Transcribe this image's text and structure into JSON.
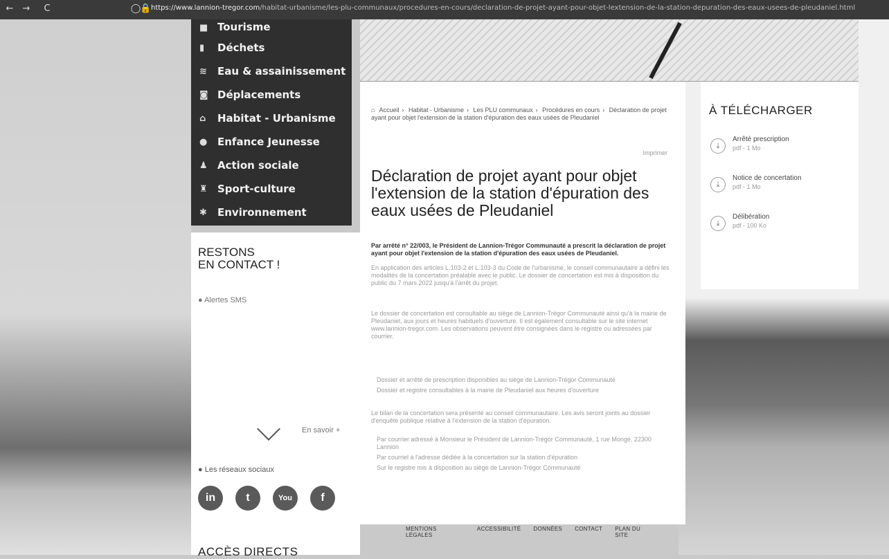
{
  "browser": {
    "back": "←",
    "forward": "→",
    "reload": "C",
    "url_domain": "https://www.lannion-tregor.com",
    "url_path": "/habitat-urbanisme/les-plu-communaux/procedures-en-cours/declaration-de-projet-ayant-pour-objet-lextension-de-la-station-depuration-des-eaux-usees-de-pleudaniel.html"
  },
  "menu": {
    "items": [
      {
        "label": "Tourisme",
        "icon": "camera-icon"
      },
      {
        "label": "Déchets",
        "icon": "trash-icon"
      },
      {
        "label": "Eau & assainissement",
        "icon": "water-icon"
      },
      {
        "label": "Déplacements",
        "icon": "bus-icon"
      },
      {
        "label": "Habitat - Urbanisme",
        "icon": "house-icon"
      },
      {
        "label": "Enfance Jeunesse",
        "icon": "child-icon"
      },
      {
        "label": "Action sociale",
        "icon": "people-icon"
      },
      {
        "label": "Sport-culture",
        "icon": "culture-icon"
      },
      {
        "label": "Environnement",
        "icon": "leaf-icon"
      }
    ]
  },
  "contact": {
    "title_line1": "RESTONS",
    "title_line2": "EN CONTACT !",
    "sms_label": "Alertes SMS",
    "more_label": "En savoir +",
    "social_label": "Les réseaux sociaux",
    "socials": [
      {
        "name": "linkedin",
        "glyph": "in"
      },
      {
        "name": "twitter",
        "glyph": "t"
      },
      {
        "name": "youtube",
        "glyph": "You"
      },
      {
        "name": "facebook",
        "glyph": "f"
      }
    ],
    "acces_directs": "ACCÈS DIRECTS"
  },
  "breadcrumb": {
    "items": [
      "Accueil",
      "Habitat - Urbanisme",
      "Les PLU communaux",
      "Procédures en cours",
      "Déclaration de projet ayant pour objet l'extension de la station d'épuration des eaux usées de Pleudaniel"
    ]
  },
  "article": {
    "print_label": "Imprimer",
    "title": "Déclaration de projet ayant pour objet l'extension de la station d'épuration des eaux usées de Pleudaniel",
    "lead": "Par arrêté n° 22/003, le Président de Lannion-Trégor Communauté a prescrit la déclaration de projet ayant pour objet l'extension de la station d'épuration des eaux usées de Pleudaniel.",
    "para1": "En application des articles L.103-2 et L.103-3 du Code de l'urbanisme, le conseil communautaire a défini les modalités de la concertation préalable avec le public. Le dossier de concertation est mis à disposition du public du 7 mars 2022 jusqu'à l'arrêt du projet.",
    "para2": "Le dossier de concertation est consultable au siège de Lannion-Trégor Communauté ainsi qu'à la mairie de Pleudaniel, aux jours et heures habituels d'ouverture. Il est également consultable sur le site internet www.lannion-tregor.com. Les observations peuvent être consignées dans le registre ou adressées par courrier.",
    "bullets1": [
      "Dossier et arrêté de prescription disponibles au siège de Lannion-Trégor Communauté",
      "Dossier et registre consultables à la mairie de Pleudaniel aux heures d'ouverture"
    ],
    "para3": "Le bilan de la concertation sera présenté au conseil communautaire. Les avis seront joints au dossier d'enquête publique relative à l'extension de la station d'épuration.",
    "bullets2": [
      "Par courrier adressé à Monsieur le Président de Lannion-Trégor Communauté, 1 rue Monge, 22300 Lannion",
      "Par courriel à l'adresse dédiée à la concertation sur la station d'épuration",
      "Sur le registre mis à disposition au siège de Lannion-Trégor Communauté"
    ]
  },
  "downloads": {
    "title": "À TÉLÉCHARGER",
    "items": [
      {
        "title": "Arrêté prescription",
        "meta": "pdf - 1 Mo"
      },
      {
        "title": "Notice de concertation",
        "meta": "pdf - 1 Mo"
      },
      {
        "title": "Délibération",
        "meta": "pdf - 100 Ko"
      }
    ]
  },
  "footer": {
    "links": [
      "MENTIONS LÉGALES",
      "ACCESSIBILITÉ",
      "DONNÉES",
      "CONTACT",
      "PLAN DU SITE"
    ]
  }
}
